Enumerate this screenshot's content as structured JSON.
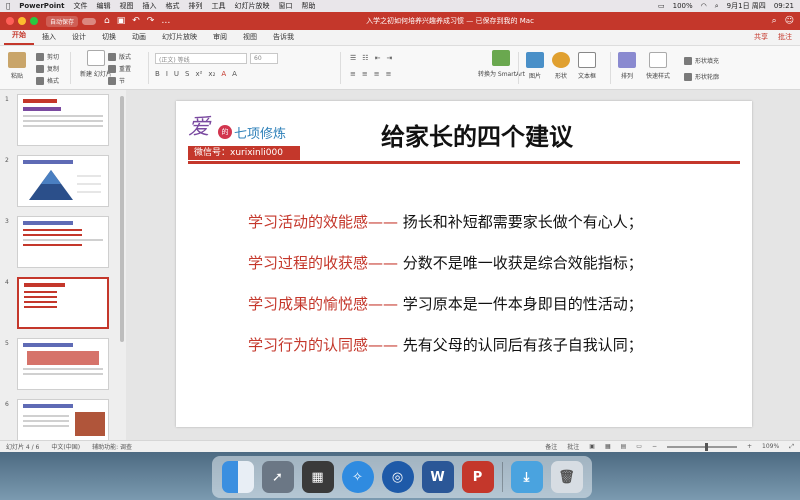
{
  "menubar": {
    "apple": "",
    "app_name": "PowerPoint",
    "items": [
      "文件",
      "编辑",
      "视图",
      "插入",
      "格式",
      "排列",
      "工具",
      "幻灯片放映",
      "窗口",
      "帮助"
    ],
    "battery": "100%",
    "date": "9月1日 周四",
    "time": "09:21"
  },
  "titlebar": {
    "autosave_label": "自动保存",
    "window_title": "入学之初如何培养兴趣养成习惯 — 已保存到我的 Mac"
  },
  "tabs": [
    "开始",
    "插入",
    "设计",
    "切换",
    "动画",
    "幻灯片放映",
    "审阅",
    "视图",
    "告诉我"
  ],
  "active_tab": "开始",
  "share": {
    "share_label": "共享",
    "comment_label": "批注"
  },
  "ribbon": {
    "paste": "粘贴",
    "cut": "剪切",
    "copy": "复制",
    "format": "格式",
    "new_slide": "新建\n幻灯片",
    "layout": "版式",
    "reset": "重置",
    "section": "节",
    "font_placeholder": "(正文) 等线",
    "size_placeholder": "60",
    "convert_smartart": "转换为\nSmartArt",
    "picture": "图片",
    "shapes": "形状",
    "textbox": "文本框",
    "arrange": "排列",
    "quick_styles": "快速样式",
    "shape_fill": "形状填充",
    "shape_outline": "形状轮廓"
  },
  "thumbnails": [
    {
      "num": "1"
    },
    {
      "num": "2"
    },
    {
      "num": "3"
    },
    {
      "num": "4",
      "selected": true
    },
    {
      "num": "5"
    },
    {
      "num": "6"
    }
  ],
  "slide": {
    "logo_script": "爱",
    "logo_circle": "的",
    "logo_brand": "七项修炼",
    "wechat": "微信号：xurixinli000",
    "title": "给家长的四个建议",
    "rows": [
      {
        "key": "学习活动的效能感——",
        "value": "扬长和补短都需要家长做个有心人；"
      },
      {
        "key": "学习过程的收获感——",
        "value": "分数不是唯一收获是综合效能指标；"
      },
      {
        "key": "学习成果的愉悦感——",
        "value": "学习原本是一件本身即目的性活动；"
      },
      {
        "key": "学习行为的认同感——",
        "value": "先有父母的认同后有孩子自我认同；"
      }
    ]
  },
  "status": {
    "slide_info": "幻灯片 4 / 6",
    "language": "中文(中国)",
    "accessibility": "辅助功能: 调查",
    "notes": "备注",
    "comments": "批注",
    "zoom": "109%"
  },
  "colors": {
    "accent": "#c4372b",
    "titlebar": "#c4372b"
  }
}
